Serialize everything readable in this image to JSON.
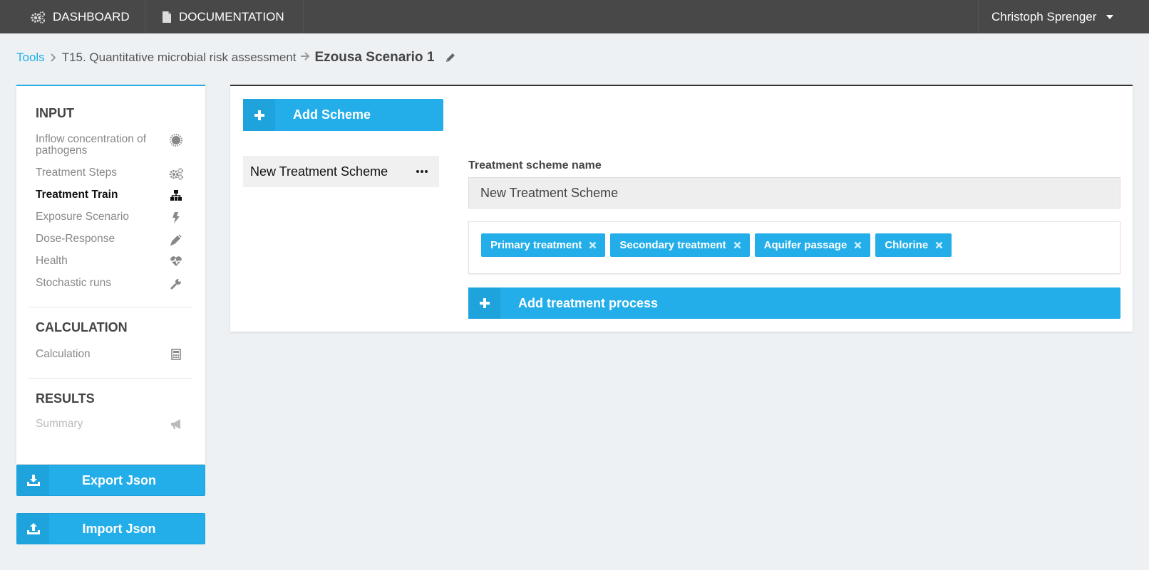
{
  "nav": {
    "dashboard_label": "DASHBOARD",
    "documentation_label": "DOCUMENTATION",
    "user_name": "Christoph Sprenger",
    "dashboard_icon": "gears-icon",
    "documentation_icon": "document-icon"
  },
  "breadcrumb": {
    "root": "Tools",
    "tool": "T15. Quantitative microbial risk assessment",
    "scenario": "Ezousa Scenario 1"
  },
  "sidebar": {
    "input_title": "INPUT",
    "input_items": [
      {
        "label": "Inflow concentration of pathogens",
        "icon": "virus-icon",
        "state": "normal"
      },
      {
        "label": "Treatment Steps",
        "icon": "gears-icon",
        "state": "normal"
      },
      {
        "label": "Treatment Train",
        "icon": "sitemap-icon",
        "state": "active"
      },
      {
        "label": "Exposure Scenario",
        "icon": "bolt-icon",
        "state": "normal"
      },
      {
        "label": "Dose-Response",
        "icon": "syringe-icon",
        "state": "normal"
      },
      {
        "label": "Health",
        "icon": "heartbeat-icon",
        "state": "normal"
      },
      {
        "label": "Stochastic runs",
        "icon": "wrench-icon",
        "state": "normal"
      }
    ],
    "calculation_title": "CALCULATION",
    "calculation_items": [
      {
        "label": "Calculation",
        "icon": "calculator-icon",
        "state": "normal"
      }
    ],
    "results_title": "RESULTS",
    "results_items": [
      {
        "label": "Summary",
        "icon": "bullhorn-icon",
        "state": "disabled"
      }
    ],
    "export_label": "Export Json",
    "import_label": "Import Json"
  },
  "main": {
    "add_scheme_label": "Add Scheme",
    "scheme_list": [
      {
        "name": "New Treatment Scheme"
      }
    ],
    "field_label": "Treatment scheme name",
    "scheme_name_value": "New Treatment Scheme",
    "tags": [
      {
        "label": "Primary treatment"
      },
      {
        "label": "Secondary treatment"
      },
      {
        "label": "Aquifer passage"
      },
      {
        "label": "Chlorine"
      }
    ],
    "add_process_label": "Add treatment process"
  },
  "colors": {
    "accent": "#23aee9",
    "topbar": "#484848",
    "background": "#eef1f4"
  }
}
